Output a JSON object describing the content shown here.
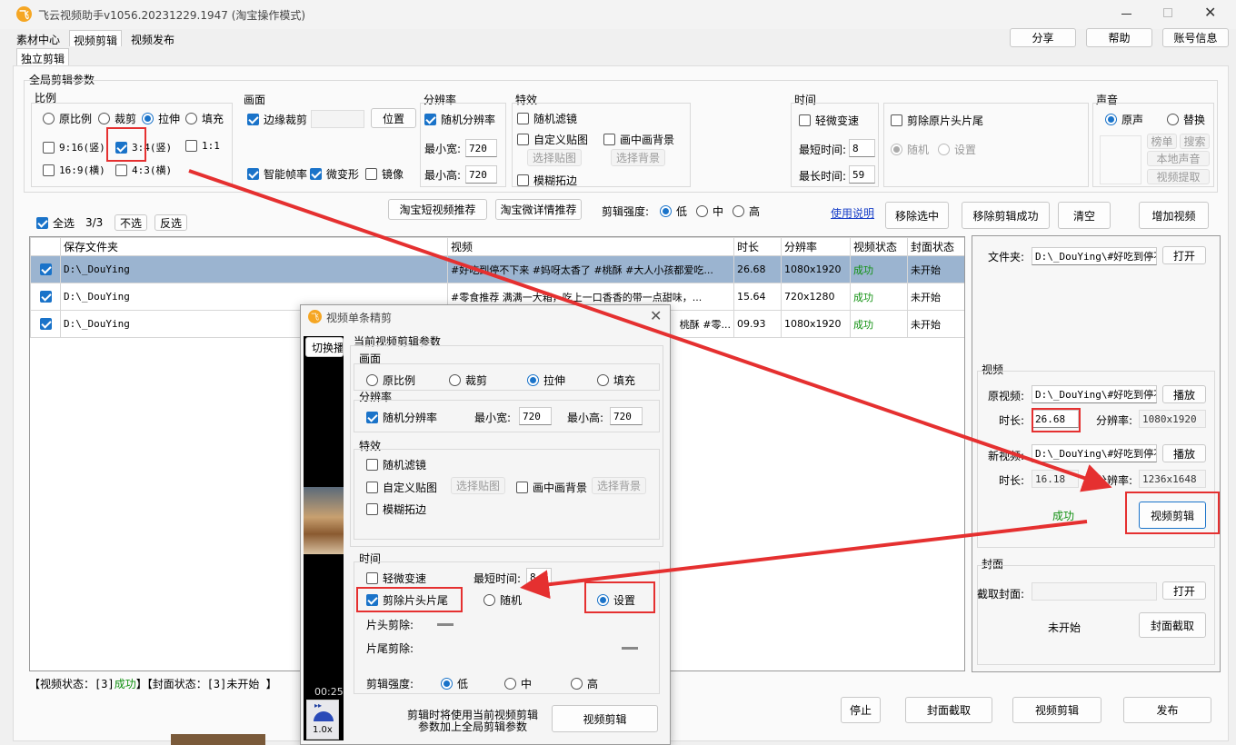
{
  "window": {
    "title": "飞云视频助手v1056.20231229.1947 (淘宝操作模式)"
  },
  "menu_tabs": [
    "素材中心",
    "视频剪辑",
    "视频发布"
  ],
  "sub_tab": "独立剪辑",
  "top_buttons": {
    "share": "分享",
    "help": "帮助",
    "account": "账号信息"
  },
  "global": {
    "title": "全局剪辑参数",
    "ratio": {
      "label": "比例",
      "options": [
        "原比例",
        "裁剪",
        "拉伸",
        "填充"
      ],
      "selected": "拉伸",
      "sizes": [
        {
          "label": "9:16(竖)",
          "checked": false
        },
        {
          "label": "3:4(竖)",
          "checked": true
        },
        {
          "label": "1:1",
          "checked": false
        },
        {
          "label": "16:9(横)",
          "checked": false
        },
        {
          "label": "4:3(横)",
          "checked": false
        }
      ]
    },
    "picture": {
      "label": "画面",
      "edge_crop": "边缘裁剪",
      "position_btn": "位置",
      "smart_fps": "智能帧率",
      "micro_deform": "微变形",
      "mirror": "镜像"
    },
    "resolution": {
      "label": "分辨率",
      "random": "随机分辨率",
      "min_w_label": "最小宽:",
      "min_w": "720",
      "min_h_label": "最小高:",
      "min_h": "720"
    },
    "effects": {
      "label": "特效",
      "random_filter": "随机滤镜",
      "custom_sticker": "自定义贴图",
      "select_sticker": "选择贴图",
      "pip_bg": "画中画背景",
      "select_bg": "选择背景",
      "blur_edge": "模糊拓边"
    },
    "time": {
      "label": "时间",
      "slight_speed": "轻微变速",
      "min_time_label": "最短时间:",
      "min_time": "8",
      "max_time_label": "最长时间:",
      "max_time": "59",
      "trim": "剪除原片头片尾",
      "random": "随机",
      "setting": "设置"
    },
    "sound": {
      "label": "声音",
      "original": "原声",
      "replace": "替换",
      "rank": "榜单",
      "search": "搜索",
      "local": "本地声音",
      "extract": "视频提取"
    }
  },
  "toolbar": {
    "select_all": "全选",
    "count": "3/3",
    "deselect": "不选",
    "invert": "反选",
    "taobao_short": "淘宝短视频推荐",
    "taobao_detail": "淘宝微详情推荐",
    "strength_label": "剪辑强度:",
    "strength_opts": [
      "低",
      "中",
      "高"
    ],
    "usage": "使用说明",
    "remove_selected": "移除选中",
    "remove_success": "移除剪辑成功",
    "clear": "清空",
    "add_video": "增加视频"
  },
  "table": {
    "headers": [
      "保存文件夹",
      "视频",
      "时长",
      "分辨率",
      "视频状态",
      "封面状态"
    ],
    "rows": [
      {
        "folder": "D:\\_DouYing",
        "video": "#好吃到停不下来 #妈呀太香了 #桃酥 #大人小孩都爱吃...",
        "duration": "26.68",
        "res": "1080x1920",
        "status": "成功",
        "cover": "未开始"
      },
      {
        "folder": "D:\\_DouYing",
        "video": "#零食推荐 满满一大箱，吃上一口香香的带一点甜味，...",
        "duration": "15.64",
        "res": "720x1280",
        "status": "成功",
        "cover": "未开始"
      },
      {
        "folder": "D:\\_DouYing",
        "video": "桃酥 #零...",
        "duration": "09.93",
        "res": "1080x1920",
        "status": "成功",
        "cover": "未开始"
      }
    ]
  },
  "status_bar": {
    "prefix": "【视频状态：[3]",
    "ok": "成功",
    "mid": "】【封面状态：[3]未开始 】"
  },
  "right": {
    "folder_label": "文件夹:",
    "folder": "D:\\_DouYing\\#好吃到停不",
    "open": "打开",
    "video_label": "视频",
    "orig_label": "原视频:",
    "orig": "D:\\_DouYing\\#好吃到停不",
    "play": "播放",
    "dur_label": "时长:",
    "orig_dur": "26.68",
    "res_label": "分辨率:",
    "orig_res": "1080x1920",
    "new_label": "新视频:",
    "new": "D:\\_DouYing\\#好吃到停不",
    "new_dur": "16.18",
    "new_res": "1236x1648",
    "success": "成功",
    "edit_btn": "视频剪辑",
    "cover_label": "封面",
    "capture_label": "截取封面:",
    "not_started": "未开始",
    "capture_btn": "封面截取"
  },
  "bottom": {
    "stop": "停止",
    "cover": "封面截取",
    "edit": "视频剪辑",
    "publish": "发布"
  },
  "dialog": {
    "title": "视频单条精剪",
    "switch": "切换播",
    "params": "当前视频剪辑参数",
    "picture": "画面",
    "ratio_opts": [
      "原比例",
      "裁剪",
      "拉伸",
      "填充"
    ],
    "ratio_sel": "拉伸",
    "res": "分辨率",
    "random_res": "随机分辨率",
    "min_w_label": "最小宽:",
    "min_w": "720",
    "min_h_label": "最小高:",
    "min_h": "720",
    "effects": "特效",
    "random_filter": "随机滤镜",
    "custom_sticker": "自定义贴图",
    "select_sticker": "选择贴图",
    "pip": "画中画背景",
    "select_bg": "选择背景",
    "blur": "模糊拓边",
    "time": "时间",
    "slight_speed": "轻微变速",
    "min_time_label": "最短时间:",
    "min_time": "8",
    "trim": "剪除片头片尾",
    "random": "随机",
    "setting": "设置",
    "head_label": "片头剪除:",
    "tail_label": "片尾剪除:",
    "strength_label": "剪辑强度:",
    "strength_opts": [
      "低",
      "中",
      "高"
    ],
    "note1": "剪辑时将使用当前视频剪辑",
    "note2": "参数加上全局剪辑参数",
    "edit_btn": "视频剪辑",
    "time_code": "00:25",
    "speed": "1.0x"
  }
}
